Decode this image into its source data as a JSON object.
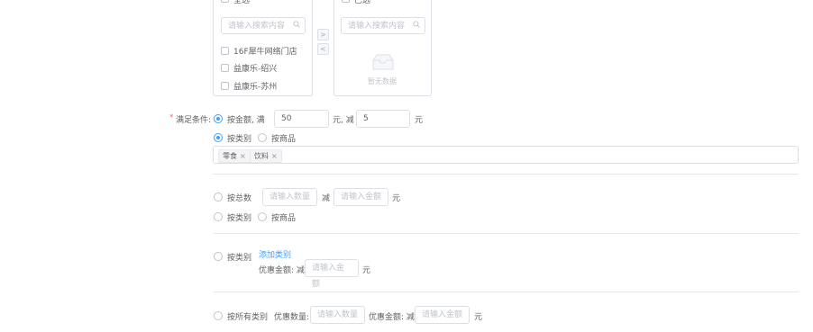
{
  "transfer": {
    "left_header": "全选",
    "right_header": "已选",
    "left_search_placeholder": "请输入搜索内容",
    "right_search_placeholder": "请输入搜索内容",
    "left_items": [
      "16F犀牛网络门店",
      "益康乐-绍兴",
      "益康乐-苏州"
    ],
    "right_empty_text": "暂无数据",
    "to_right_label": ">",
    "to_left_label": "<"
  },
  "condition": {
    "label": "满足条件:",
    "required_mark": "*",
    "amount": {
      "option_label": "按金额, 满",
      "full_value": "50",
      "unit_after_full": "元, 减",
      "reduce_value": "5",
      "unit": "元"
    },
    "scope": {
      "category_label": "按类别",
      "product_label": "按商品"
    },
    "tags": [
      "零食",
      "饮料"
    ],
    "total_count": {
      "option_label": "按总数",
      "count_placeholder": "请输入数量",
      "reduce_label": "减",
      "amount_placeholder": "请输入金额",
      "unit": "元",
      "category_label": "按类别",
      "product_label": "按商品"
    },
    "by_category": {
      "option_label": "按类别",
      "add_link": "添加类别",
      "discount_label": "优惠金额: 减",
      "amount_placeholder": "请输入金额",
      "unit": "元"
    },
    "all_categories": {
      "option_label": "按所有类别",
      "discount_count_label": "优惠数量:",
      "count_placeholder": "请输入数量",
      "discount_amount_label": "优惠金额: 减",
      "amount_placeholder": "请输入金额",
      "unit": "元"
    }
  }
}
